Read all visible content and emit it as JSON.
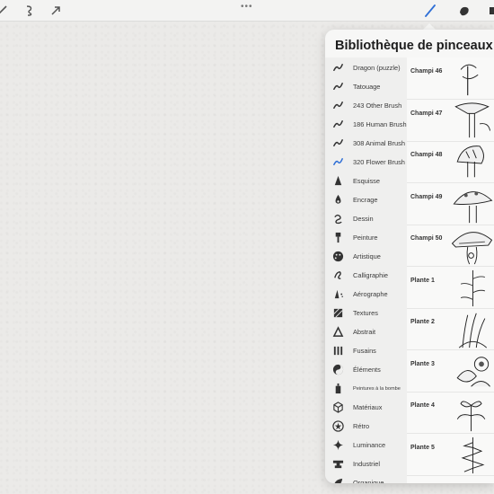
{
  "panel": {
    "title": "Bibliothèque de pinceaux"
  },
  "toolbar": {
    "icons": [
      "wrench-icon",
      "adjustments-icon",
      "selection-icon",
      "transform-icon",
      "brush-icon",
      "smudge-icon",
      "eraser-icon"
    ],
    "more_label": "•••",
    "accent_color": "#2f6fd6"
  },
  "categories": [
    {
      "label": "Dragon (puzzle)",
      "icon": "stroke-icon"
    },
    {
      "label": "Tatouage",
      "icon": "stroke-icon"
    },
    {
      "label": "243 Other Brush",
      "icon": "stroke-icon"
    },
    {
      "label": "186 Human Brush",
      "icon": "stroke-icon"
    },
    {
      "label": "308 Animal Brush",
      "icon": "stroke-icon"
    },
    {
      "label": "320 Flower Brush",
      "icon": "stroke-icon",
      "selected": true
    },
    {
      "label": "Esquisse",
      "icon": "pencil-tip-icon"
    },
    {
      "label": "Encrage",
      "icon": "ink-drop-icon"
    },
    {
      "label": "Dessin",
      "icon": "swirl-icon"
    },
    {
      "label": "Peinture",
      "icon": "paint-brush-icon"
    },
    {
      "label": "Artistique",
      "icon": "palette-icon"
    },
    {
      "label": "Calligraphie",
      "icon": "calligraphy-icon"
    },
    {
      "label": "Aérographe",
      "icon": "airbrush-icon"
    },
    {
      "label": "Textures",
      "icon": "texture-icon"
    },
    {
      "label": "Abstrait",
      "icon": "triangle-icon"
    },
    {
      "label": "Fusains",
      "icon": "charcoal-icon"
    },
    {
      "label": "Éléments",
      "icon": "yin-yang-icon"
    },
    {
      "label": "Peintures à la bombe",
      "icon": "spray-can-icon"
    },
    {
      "label": "Matériaux",
      "icon": "cube-icon"
    },
    {
      "label": "Rétro",
      "icon": "retro-star-icon"
    },
    {
      "label": "Luminance",
      "icon": "sparkle-icon"
    },
    {
      "label": "Industriel",
      "icon": "anvil-icon"
    },
    {
      "label": "Organique",
      "icon": "leaf-icon"
    }
  ],
  "brushes": [
    {
      "label": "Champi 46",
      "thumb": "mushroom-drawing"
    },
    {
      "label": "Champi 47",
      "thumb": "mushroom-drawing"
    },
    {
      "label": "Champi 48",
      "thumb": "mushroom-drawing"
    },
    {
      "label": "Champi 49",
      "thumb": "mushroom-drawing"
    },
    {
      "label": "Champi 50",
      "thumb": "mushroom-drawing"
    },
    {
      "label": "Plante 1",
      "thumb": "plant-drawing"
    },
    {
      "label": "Plante 2",
      "thumb": "plant-drawing"
    },
    {
      "label": "Plante 3",
      "thumb": "plant-drawing"
    },
    {
      "label": "Plante 4",
      "thumb": "plant-drawing"
    },
    {
      "label": "Plante 5",
      "thumb": "plant-drawing"
    }
  ]
}
